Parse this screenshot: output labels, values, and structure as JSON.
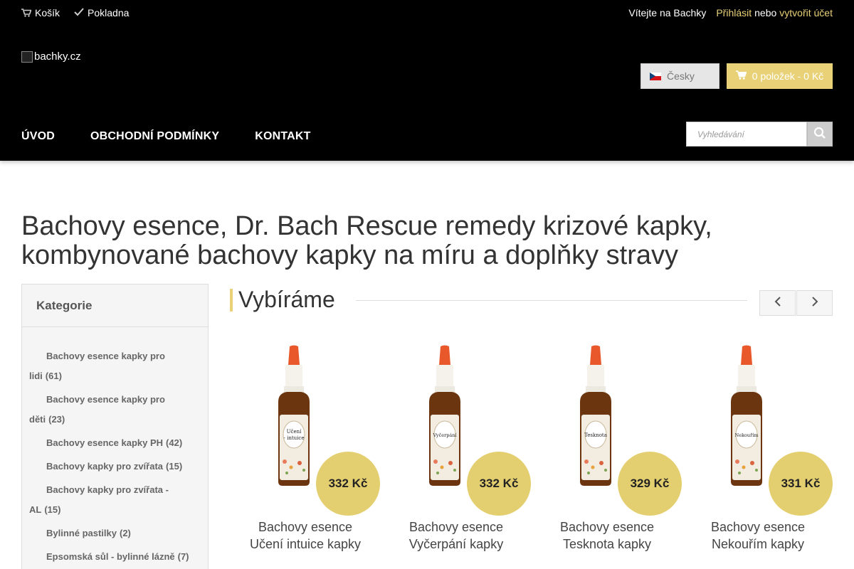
{
  "topbar": {
    "cart_label": "Košík",
    "checkout_label": "Pokladna",
    "welcome": "Vítejte na Bachky",
    "login": "Přihlásit",
    "or": "nebo",
    "register": "vytvořit účet"
  },
  "logo": {
    "alt": "bachky.cz"
  },
  "language": {
    "label": "Česky"
  },
  "cart": {
    "label": "0 položek - 0 Kč"
  },
  "nav": {
    "items": [
      {
        "label": "Úvod"
      },
      {
        "label": "Obchodní podmínky"
      },
      {
        "label": "Kontakt"
      }
    ]
  },
  "search": {
    "placeholder": "Vyhledávání"
  },
  "page": {
    "title": "Bachovy esence, Dr. Bach Rescue remedy krizové kapky, kombynované bachovy kapky na míru a doplňky stravy"
  },
  "sidebar": {
    "title": "Kategorie",
    "categories": [
      {
        "name": "Bachovy esence kapky pro lidi",
        "count": "(61)"
      },
      {
        "name": "Bachovy esence kapky pro děti",
        "count": "(23)"
      },
      {
        "name": "Bachovy esence kapky PH",
        "count": "(42)"
      },
      {
        "name": "Bachovy kapky pro zvířata",
        "count": "(15)"
      },
      {
        "name": "Bachovy kapky pro zvířata - AL",
        "count": "(15)"
      },
      {
        "name": "Bylinné pastilky",
        "count": "(2)"
      },
      {
        "name": "Epsomská sůl - bylinné lázně",
        "count": "(7)"
      }
    ]
  },
  "featured": {
    "title": "Vybíráme",
    "products": [
      {
        "name_line1": "Bachovy esence",
        "name_line2": "Učení intuice kapky",
        "label_line1": "Učení",
        "label_line2": "- intuice",
        "price": "332 Kč"
      },
      {
        "name_line1": "Bachovy esence",
        "name_line2": "Vyčerpání kapky",
        "label_line1": "Vyčerpání",
        "label_line2": "",
        "price": "332 Kč"
      },
      {
        "name_line1": "Bachovy esence",
        "name_line2": "Tesknota kapky",
        "label_line1": "Tesknota",
        "label_line2": "",
        "price": "329 Kč"
      },
      {
        "name_line1": "Bachovy esence",
        "name_line2": "Nekouřím kapky",
        "label_line1": "Nekouřím",
        "label_line2": "",
        "price": "331 Kč"
      }
    ]
  },
  "colors": {
    "header_bg": "#000000",
    "accent": "#e8d177",
    "price_badge": "#e4cf70"
  }
}
